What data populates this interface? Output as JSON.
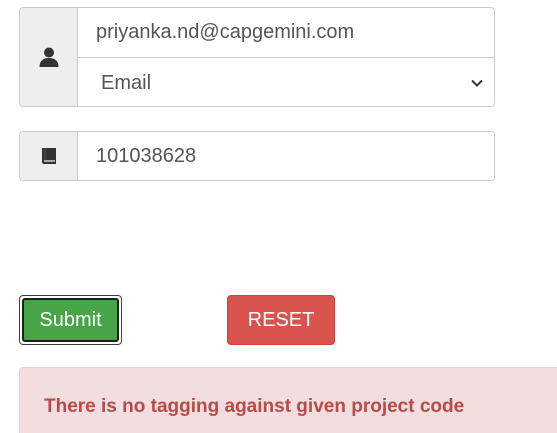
{
  "form": {
    "identifier": {
      "icon": "user-icon",
      "value": "priyanka.nd@capgemini.com"
    },
    "identifier_type": {
      "selected": "Email",
      "icon": "chevron-down-icon"
    },
    "project_code": {
      "icon": "book-icon",
      "value": "101038628"
    }
  },
  "buttons": {
    "submit_label": "Submit",
    "reset_label": "RESET"
  },
  "alert": {
    "message": "There is no tagging against given project code"
  },
  "colors": {
    "submit": "#47a447",
    "reset": "#d9534f",
    "alert_bg": "#f2dede",
    "alert_text": "#b94a48"
  }
}
